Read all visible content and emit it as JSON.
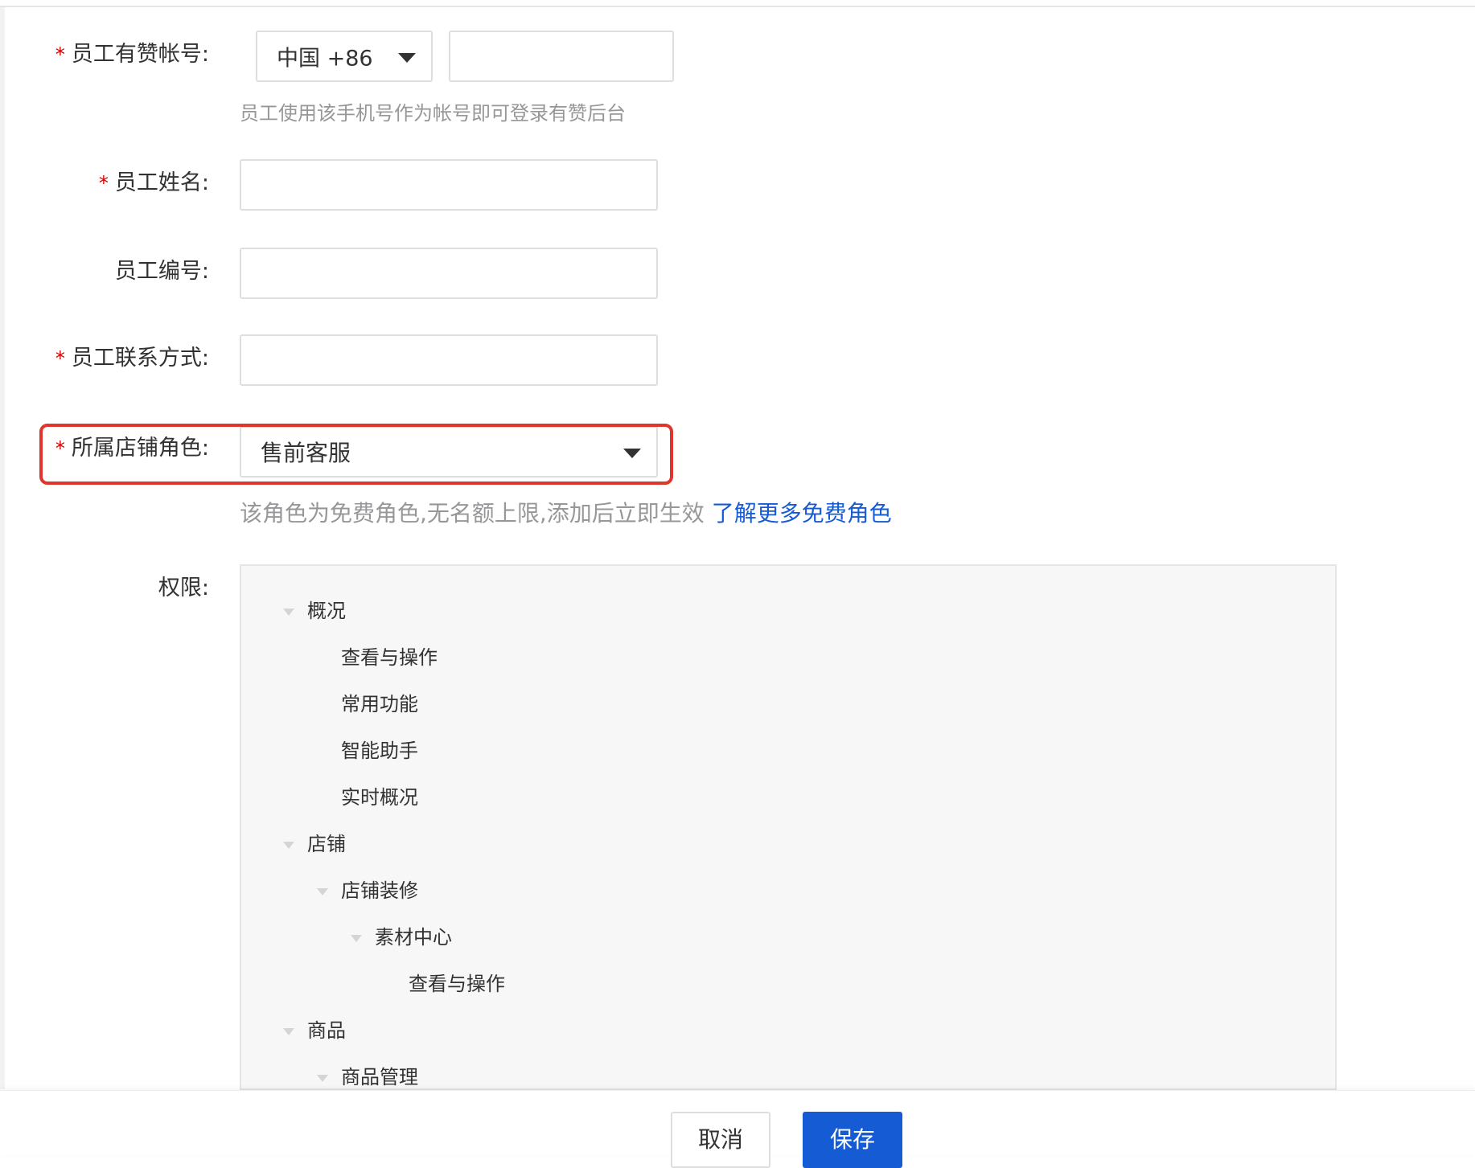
{
  "form": {
    "account": {
      "label": "员工有赞帐号:",
      "required": true,
      "country_select": "中国 +86",
      "phone_value": "",
      "help": "员工使用该手机号作为帐号即可登录有赞后台"
    },
    "name": {
      "label": "员工姓名:",
      "required": true,
      "value": ""
    },
    "number": {
      "label": "员工编号:",
      "required": false,
      "value": ""
    },
    "contact": {
      "label": "员工联系方式:",
      "required": true,
      "value": ""
    },
    "role": {
      "label": "所属店铺角色:",
      "required": true,
      "selected": "售前客服",
      "help": "该角色为免费角色,无名额上限,添加后立即生效",
      "help_link": "了解更多免费角色",
      "highlighted": true
    },
    "permissions": {
      "label": "权限:",
      "tree": [
        {
          "text": "概况",
          "level": 0,
          "has_children": true
        },
        {
          "text": "查看与操作",
          "level": 1,
          "has_children": false
        },
        {
          "text": "常用功能",
          "level": 1,
          "has_children": false
        },
        {
          "text": "智能助手",
          "level": 1,
          "has_children": false
        },
        {
          "text": "实时概况",
          "level": 1,
          "has_children": false
        },
        {
          "text": "店铺",
          "level": 0,
          "has_children": true
        },
        {
          "text": "店铺装修",
          "level": 1,
          "has_children": true
        },
        {
          "text": "素材中心",
          "level": 2,
          "has_children": true
        },
        {
          "text": "查看与操作",
          "level": 3,
          "has_children": false
        },
        {
          "text": "商品",
          "level": 0,
          "has_children": true
        },
        {
          "text": "商品管理",
          "level": 1,
          "has_children": true
        }
      ]
    }
  },
  "footer": {
    "cancel_label": "取消",
    "save_label": "保存"
  },
  "colors": {
    "required_star": "#d40000",
    "highlight": "#e0352b",
    "link": "#155bd4",
    "primary_button": "#155bd4"
  },
  "required_mark": "*"
}
